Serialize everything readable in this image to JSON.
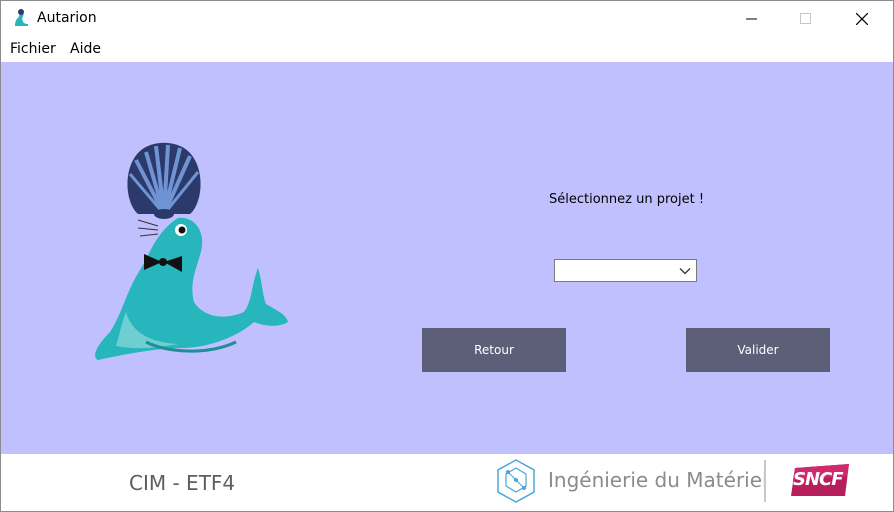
{
  "window": {
    "title": "Autarion",
    "controls": {
      "minimize_icon": "minimize-icon",
      "maximize_icon": "maximize-icon",
      "close_icon": "close-icon"
    }
  },
  "menubar": {
    "items": [
      {
        "label": "Fichier"
      },
      {
        "label": "Aide"
      }
    ]
  },
  "main": {
    "background": "#c0c0ff",
    "prompt": "Sélectionnez un projet !",
    "project_select": {
      "value": ""
    },
    "buttons": {
      "back": "Retour",
      "validate": "Valider"
    },
    "button_color": "#5d5f78"
  },
  "footer": {
    "code": "CIM - ETF4",
    "brand": "Ingénierie du Matériel",
    "sncf_logo_text": "SNCF",
    "sncf_color": "#b71f5c"
  }
}
